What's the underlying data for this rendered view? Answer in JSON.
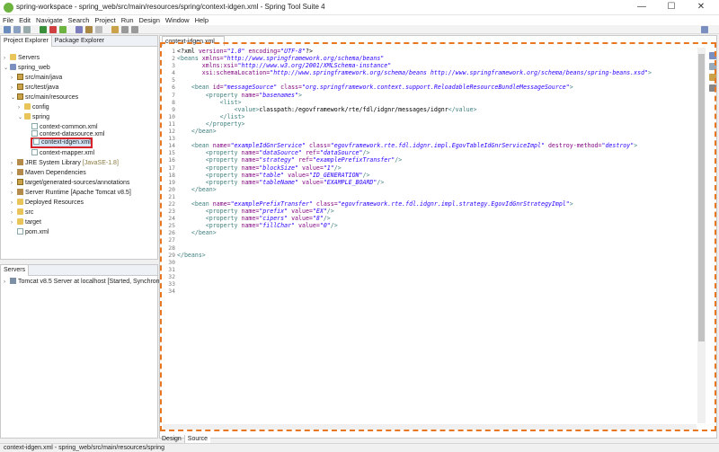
{
  "window": {
    "title": "spring-workspace - spring_web/src/main/resources/spring/context-idgen.xml - Spring Tool Suite 4",
    "minimize": "—",
    "maximize": "☐",
    "close": "✕"
  },
  "menu": [
    "File",
    "Edit",
    "Navigate",
    "Search",
    "Project",
    "Run",
    "Design",
    "Window",
    "Help"
  ],
  "explorer": {
    "tab_project": "Project Explorer",
    "tab_package": "Package Explorer",
    "tree": [
      {
        "label": "Servers",
        "extra": ""
      },
      {
        "label": "spring_web",
        "extra": ""
      },
      {
        "label": "src/main/java",
        "extra": ""
      },
      {
        "label": "src/test/java",
        "extra": ""
      },
      {
        "label": "src/main/resources",
        "extra": ""
      },
      {
        "label": "config",
        "extra": ""
      },
      {
        "label": "spring",
        "extra": ""
      },
      {
        "label": "context-common.xml",
        "extra": ""
      },
      {
        "label": "context-datasource.xml",
        "extra": ""
      },
      {
        "label": "context-idgen.xml",
        "extra": ""
      },
      {
        "label": "context-mapper.xml",
        "extra": ""
      },
      {
        "label": "JRE System Library",
        "extra": "[JavaSE-1.8]"
      },
      {
        "label": "Maven Dependencies",
        "extra": ""
      },
      {
        "label": "target/generated-sources/annotations",
        "extra": ""
      },
      {
        "label": "Server Runtime [Apache Tomcat v8.5]",
        "extra": ""
      },
      {
        "label": "Deployed Resources",
        "extra": ""
      },
      {
        "label": "src",
        "extra": ""
      },
      {
        "label": "target",
        "extra": ""
      },
      {
        "label": "pom.xml",
        "extra": ""
      }
    ]
  },
  "servers": {
    "tab": "Servers",
    "row": "Tomcat v8.5 Server at localhost  [Started, Synchroniz"
  },
  "editor": {
    "tab": "context-idgen.xml",
    "line_count": 34,
    "bottom_tabs": [
      "Design",
      "Source"
    ]
  },
  "code": [
    [
      [
        "tx",
        "<?xml "
      ],
      [
        "an",
        "version="
      ],
      [
        "av",
        "\"1.0\""
      ],
      [
        "tx",
        " "
      ],
      [
        "an",
        "encoding="
      ],
      [
        "av",
        "\"UTF-8\""
      ],
      [
        "tx",
        "?>"
      ]
    ],
    [
      [
        "tg",
        "<beans "
      ],
      [
        "an",
        "xmlns="
      ],
      [
        "av",
        "\"http://www.springframework.org/schema/beans\""
      ]
    ],
    [
      [
        "tx",
        "       "
      ],
      [
        "an",
        "xmlns:xsi="
      ],
      [
        "av",
        "\"http://www.w3.org/2001/XMLSchema-instance\""
      ]
    ],
    [
      [
        "tx",
        "       "
      ],
      [
        "an",
        "xsi:schemaLocation="
      ],
      [
        "av",
        "\"http://www.springframework.org/schema/beans http://www.springframework.org/schema/beans/spring-beans.xsd\""
      ],
      [
        "tg",
        ">"
      ]
    ],
    [
      [
        "tx",
        ""
      ]
    ],
    [
      [
        "tx",
        "    "
      ],
      [
        "tg",
        "<bean "
      ],
      [
        "an",
        "id="
      ],
      [
        "av",
        "\"messageSource\""
      ],
      [
        "tx",
        " "
      ],
      [
        "an",
        "class="
      ],
      [
        "av",
        "\"org.springframework.context.support.ReloadableResourceBundleMessageSource\""
      ],
      [
        "tg",
        ">"
      ]
    ],
    [
      [
        "tx",
        "        "
      ],
      [
        "tg",
        "<property "
      ],
      [
        "an",
        "name="
      ],
      [
        "av",
        "\"basenames\""
      ],
      [
        "tg",
        ">"
      ]
    ],
    [
      [
        "tx",
        "            "
      ],
      [
        "tg",
        "<list>"
      ]
    ],
    [
      [
        "tx",
        "                "
      ],
      [
        "tg",
        "<value>"
      ],
      [
        "tx",
        "classpath:/egovframework/rte/fdl/idgnr/messages/idgnr"
      ],
      [
        "tg",
        "</value>"
      ]
    ],
    [
      [
        "tx",
        "            "
      ],
      [
        "tg",
        "</list>"
      ]
    ],
    [
      [
        "tx",
        "        "
      ],
      [
        "tg",
        "</property>"
      ]
    ],
    [
      [
        "tx",
        "    "
      ],
      [
        "tg",
        "</bean>"
      ]
    ],
    [
      [
        "tx",
        ""
      ]
    ],
    [
      [
        "tx",
        "    "
      ],
      [
        "tg",
        "<bean "
      ],
      [
        "an",
        "name="
      ],
      [
        "av",
        "\"exampleIdGnrService\""
      ],
      [
        "tx",
        " "
      ],
      [
        "an",
        "class="
      ],
      [
        "av",
        "\"egovframework.rte.fdl.idgnr.impl.EgovTableIdGnrServiceImpl\""
      ],
      [
        "tx",
        " "
      ],
      [
        "an",
        "destroy-method="
      ],
      [
        "av",
        "\"destroy\""
      ],
      [
        "tg",
        ">"
      ]
    ],
    [
      [
        "tx",
        "        "
      ],
      [
        "tg",
        "<property "
      ],
      [
        "an",
        "name="
      ],
      [
        "av",
        "\"dataSource\""
      ],
      [
        "tx",
        " "
      ],
      [
        "an",
        "ref="
      ],
      [
        "av",
        "\"dataSource\""
      ],
      [
        "tg",
        "/>"
      ]
    ],
    [
      [
        "tx",
        "        "
      ],
      [
        "tg",
        "<property "
      ],
      [
        "an",
        "name="
      ],
      [
        "av",
        "\"strategy\""
      ],
      [
        "tx",
        " "
      ],
      [
        "an",
        "ref="
      ],
      [
        "av",
        "\"examplePrefixTransfer\""
      ],
      [
        "tg",
        "/>"
      ]
    ],
    [
      [
        "tx",
        "        "
      ],
      [
        "tg",
        "<property "
      ],
      [
        "an",
        "name="
      ],
      [
        "av",
        "\"blockSize\""
      ],
      [
        "tx",
        " "
      ],
      [
        "an",
        "value="
      ],
      [
        "av",
        "\"1\""
      ],
      [
        "tg",
        "/>"
      ]
    ],
    [
      [
        "tx",
        "        "
      ],
      [
        "tg",
        "<property "
      ],
      [
        "an",
        "name="
      ],
      [
        "av",
        "\"table\""
      ],
      [
        "tx",
        " "
      ],
      [
        "an",
        "value="
      ],
      [
        "av",
        "\"ID_GENERATION\""
      ],
      [
        "tg",
        "/>"
      ]
    ],
    [
      [
        "tx",
        "        "
      ],
      [
        "tg",
        "<property "
      ],
      [
        "an",
        "name="
      ],
      [
        "av",
        "\"tableName\""
      ],
      [
        "tx",
        " "
      ],
      [
        "an",
        "value="
      ],
      [
        "av",
        "\"EXAMPLE_BOARD\""
      ],
      [
        "tg",
        "/>"
      ]
    ],
    [
      [
        "tx",
        "    "
      ],
      [
        "tg",
        "</bean>"
      ]
    ],
    [
      [
        "tx",
        ""
      ]
    ],
    [
      [
        "tx",
        "    "
      ],
      [
        "tg",
        "<bean "
      ],
      [
        "an",
        "name="
      ],
      [
        "av",
        "\"examplePrefixTransfer\""
      ],
      [
        "tx",
        " "
      ],
      [
        "an",
        "class="
      ],
      [
        "av",
        "\"egovframework.rte.fdl.idgnr.impl.strategy.EgovIdGnrStrategyImpl\""
      ],
      [
        "tg",
        ">"
      ]
    ],
    [
      [
        "tx",
        "        "
      ],
      [
        "tg",
        "<property "
      ],
      [
        "an",
        "name="
      ],
      [
        "av",
        "\"prefix\""
      ],
      [
        "tx",
        " "
      ],
      [
        "an",
        "value="
      ],
      [
        "av",
        "\"EX\""
      ],
      [
        "tg",
        "/>"
      ]
    ],
    [
      [
        "tx",
        "        "
      ],
      [
        "tg",
        "<property "
      ],
      [
        "an",
        "name="
      ],
      [
        "av",
        "\"cipers\""
      ],
      [
        "tx",
        " "
      ],
      [
        "an",
        "value="
      ],
      [
        "av",
        "\"8\""
      ],
      [
        "tg",
        "/>"
      ]
    ],
    [
      [
        "tx",
        "        "
      ],
      [
        "tg",
        "<property "
      ],
      [
        "an",
        "name="
      ],
      [
        "av",
        "\"fillChar\""
      ],
      [
        "tx",
        " "
      ],
      [
        "an",
        "value="
      ],
      [
        "av",
        "\"0\""
      ],
      [
        "tg",
        "/>"
      ]
    ],
    [
      [
        "tx",
        "    "
      ],
      [
        "tg",
        "</bean>"
      ]
    ],
    [
      [
        "tx",
        ""
      ]
    ],
    [
      [
        "tx",
        ""
      ]
    ],
    [
      [
        "tg",
        "</beans>"
      ]
    ],
    [
      [
        "tx",
        ""
      ]
    ],
    [
      [
        "tx",
        ""
      ]
    ],
    [
      [
        "tx",
        ""
      ]
    ],
    [
      [
        "tx",
        ""
      ]
    ],
    [
      [
        "tx",
        ""
      ]
    ]
  ],
  "status": "context-idgen.xml - spring_web/src/main/resources/spring"
}
